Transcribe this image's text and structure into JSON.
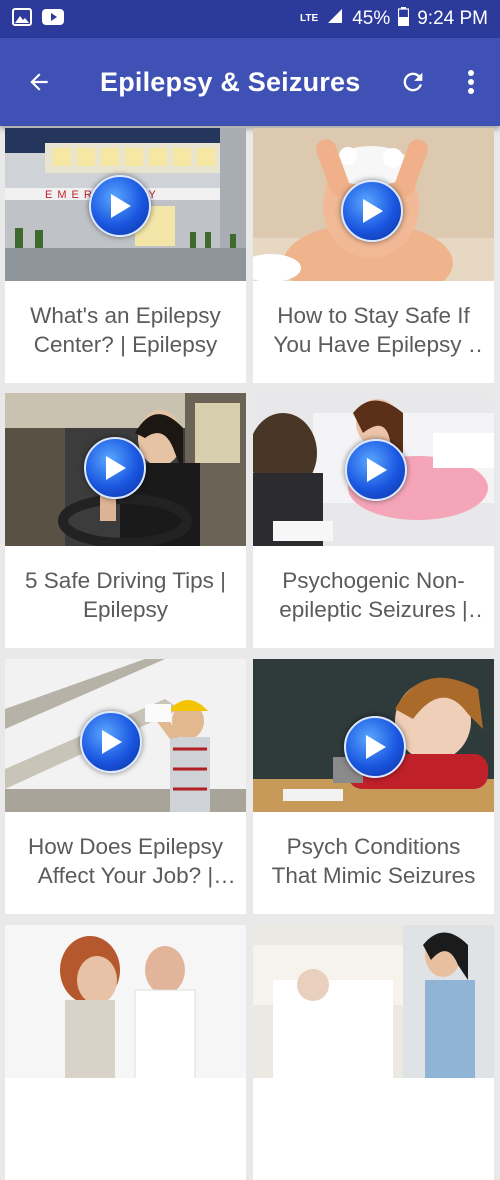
{
  "status_bar": {
    "network": "LTE",
    "battery": "45%",
    "time": "9:24 PM",
    "icons": [
      "image-icon",
      "youtube-icon",
      "signal-icon",
      "battery-icon"
    ]
  },
  "app_bar": {
    "title": "Epilepsy & Seizures",
    "icons": [
      "back-arrow-icon",
      "refresh-icon",
      "overflow-menu-icon"
    ],
    "color": "#3f51b5"
  },
  "videos": [
    {
      "title": "What's an Epilepsy Center? | Epilepsy"
    },
    {
      "title": "How to Stay Safe If You Have Epilepsy | Epilepsy"
    },
    {
      "title": "5 Safe Driving Tips | Epilepsy"
    },
    {
      "title": "Psychogenic Non-epileptic Seizures | Epilepsy"
    },
    {
      "title": "How Does Epilepsy Affect Your Job? | Epilepsy"
    },
    {
      "title": "Psych Conditions That Mimic Seizures"
    },
    {
      "title": ""
    },
    {
      "title": ""
    }
  ]
}
